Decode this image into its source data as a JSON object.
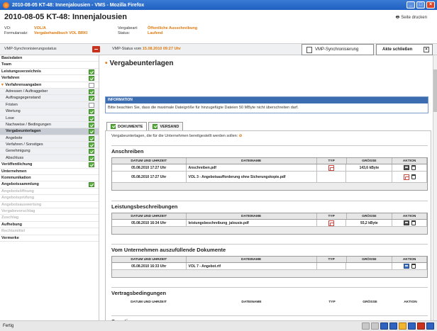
{
  "window": {
    "title": "2010-08-05 KT-48: Innenjalousien - VMS - Mozilla Firefox"
  },
  "header": {
    "title": "2010-08-05 KT-48: Innenjalousien",
    "print_label": "Seite drucken",
    "fields": {
      "vo_label": "VO:",
      "vo_value": "VOL/A",
      "formular_label": "Formularsatz:",
      "formular_value": "Vergabehandbuch VOL BRKI",
      "vergabeart_label": "Vergabeart:",
      "vergabeart_value": "Öffentliche Ausschreibung",
      "status_label": "Status:",
      "status_value": "Laufend"
    }
  },
  "statusrow": {
    "vmp_sync_label": "VMP-Synchronisierungsstatus",
    "vmp_status_prefix": "VMP-Status vom",
    "vmp_status_value": "15.08.2010 09:27 Uhr",
    "sync_button": "VMP-Synchronisierung",
    "close_button": "Akte schließen"
  },
  "sidebar": {
    "items": [
      {
        "label": "Basisdaten",
        "style": "bold",
        "check": "none"
      },
      {
        "label": "Team",
        "style": "bold",
        "check": "none"
      },
      {
        "label": "Leistungsverzeichnis",
        "style": "bold",
        "check": "green"
      },
      {
        "label": "Verfahren",
        "style": "bold",
        "check": "green"
      },
      {
        "label": "Verfahrensangaben",
        "style": "bold open",
        "check": "empty"
      },
      {
        "label": "Adressen / Auftraggeber",
        "style": "sub",
        "check": "green"
      },
      {
        "label": "Auftragsgegenstand",
        "style": "sub",
        "check": "green"
      },
      {
        "label": "Fristen",
        "style": "sub",
        "check": "empty"
      },
      {
        "label": "Wertung",
        "style": "sub",
        "check": "green"
      },
      {
        "label": "Lose",
        "style": "sub",
        "check": "green"
      },
      {
        "label": "Nachweise / Bedingungen",
        "style": "sub",
        "check": "green"
      },
      {
        "label": "Vergabeunterlagen",
        "style": "sub active",
        "check": "green"
      },
      {
        "label": "Angebote",
        "style": "sub",
        "check": "green"
      },
      {
        "label": "Verfahren / Sonstiges",
        "style": "sub",
        "check": "green"
      },
      {
        "label": "Genehmigung",
        "style": "sub",
        "check": "green"
      },
      {
        "label": "Abschluss",
        "style": "sub",
        "check": "green"
      },
      {
        "label": "Veröffentlichung",
        "style": "bold",
        "check": "green"
      },
      {
        "label": "Unternehmen",
        "style": "bold",
        "check": "none"
      },
      {
        "label": "Kommunikation",
        "style": "bold",
        "check": "none"
      },
      {
        "label": "Angebotssammlung",
        "style": "bold",
        "check": "green"
      },
      {
        "label": "Angebotsöffnung",
        "style": "disabled",
        "check": "none"
      },
      {
        "label": "Angebotsprüfung",
        "style": "disabled",
        "check": "none"
      },
      {
        "label": "Angebotsauswertung",
        "style": "disabled",
        "check": "none"
      },
      {
        "label": "Vergabevorschlag",
        "style": "disabled",
        "check": "none"
      },
      {
        "label": "Zuschlag",
        "style": "disabled",
        "check": "none"
      },
      {
        "label": "Aufhebung",
        "style": "bold",
        "check": "none"
      },
      {
        "label": "Rechtsmittel",
        "style": "disabled",
        "check": "none"
      },
      {
        "label": "Vermerke",
        "style": "bold",
        "check": "none"
      }
    ]
  },
  "main": {
    "title": "Vergabeunterlagen",
    "info_header": "INFORMATION",
    "info_text": "Bitte beachten Sie, dass die maximale Dateigröße für hinzugefügte Dateien 50 MByte nicht überschreiten darf.",
    "tabs": [
      {
        "label": "DOKUMENTE"
      },
      {
        "label": "VERSAND"
      }
    ],
    "intro": "Vergabeunterlagen, die für die Unternehmen bereitgestellt werden sollen:",
    "intro_marker": "⊘",
    "columns": [
      "DATUM UND UHRZEIT",
      "DATEINAME",
      "TYP",
      "GRÖSSE",
      "AKTION"
    ],
    "sections": [
      {
        "title": "Anschreiben",
        "rows": [
          {
            "date": "05.08.2010 17:27 Uhr",
            "name": "Anschreiben.pdf",
            "size": "143,6 kByte"
          },
          {
            "date": "05.08.2010 17:27 Uhr",
            "name": "VOL 3 - Angebotsaufforderung ohne Sicherungskopie.pdf",
            "size": ""
          }
        ]
      },
      {
        "title": "Leistungsbeschreibungen",
        "rows": [
          {
            "date": "05.08.2010 16:34 Uhr",
            "name": "leistungsbeschreibung_jalousie.pdf",
            "size": "93,2 kByte"
          }
        ]
      },
      {
        "title": "Vom Unternehmen auszufüllende Dokumente",
        "rows": [
          {
            "date": "05.08.2010 16:33 Uhr",
            "name": "VOL 7 - Angebot.rtf",
            "size": ""
          }
        ]
      },
      {
        "title": "Vertragsbedingungen",
        "rows": []
      },
      {
        "title": "Sonstiges",
        "rows": []
      }
    ]
  },
  "statusbar": {
    "text": "Fertig"
  }
}
